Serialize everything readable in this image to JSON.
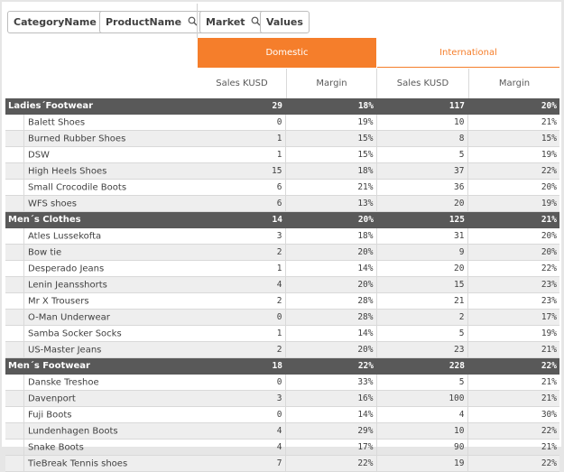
{
  "dimensions": [
    {
      "label": "CategoryName",
      "icon": "search-icon"
    },
    {
      "label": "ProductName",
      "icon": "search-icon"
    }
  ],
  "columns_dims": [
    {
      "label": "Market",
      "icon": "search-icon"
    },
    {
      "label": "Values",
      "icon": ""
    }
  ],
  "markets": [
    {
      "label": "Domestic",
      "selected": true
    },
    {
      "label": "International",
      "selected": false
    }
  ],
  "measures": [
    "Sales KUSD",
    "Margin",
    "Sales KUSD",
    "Margin"
  ],
  "colors": {
    "accent": "#f57e2b",
    "group_header": "#595959",
    "alt_row": "#eeeeee"
  },
  "groups": [
    {
      "name": "Ladies´Footwear",
      "values": [
        "29",
        "18%",
        "117",
        "20%"
      ],
      "rows": [
        {
          "name": "Balett Shoes",
          "values": [
            "0",
            "19%",
            "10",
            "21%"
          ]
        },
        {
          "name": "Burned Rubber Shoes",
          "values": [
            "1",
            "15%",
            "8",
            "15%"
          ]
        },
        {
          "name": "DSW",
          "values": [
            "1",
            "15%",
            "5",
            "19%"
          ]
        },
        {
          "name": "High Heels Shoes",
          "values": [
            "15",
            "18%",
            "37",
            "22%"
          ]
        },
        {
          "name": "Small Crocodile Boots",
          "values": [
            "6",
            "21%",
            "36",
            "20%"
          ]
        },
        {
          "name": "WFS shoes",
          "values": [
            "6",
            "13%",
            "20",
            "19%"
          ]
        }
      ]
    },
    {
      "name": "Men´s Clothes",
      "values": [
        "14",
        "20%",
        "125",
        "21%"
      ],
      "rows": [
        {
          "name": "Atles Lussekofta",
          "values": [
            "3",
            "18%",
            "31",
            "20%"
          ]
        },
        {
          "name": "Bow tie",
          "values": [
            "2",
            "20%",
            "9",
            "20%"
          ]
        },
        {
          "name": "Desperado Jeans",
          "values": [
            "1",
            "14%",
            "20",
            "22%"
          ]
        },
        {
          "name": "Lenin Jeansshorts",
          "values": [
            "4",
            "20%",
            "15",
            "23%"
          ]
        },
        {
          "name": "Mr X Trousers",
          "values": [
            "2",
            "28%",
            "21",
            "23%"
          ]
        },
        {
          "name": "O-Man Underwear",
          "values": [
            "0",
            "28%",
            "2",
            "17%"
          ]
        },
        {
          "name": "Samba Socker Socks",
          "values": [
            "1",
            "14%",
            "5",
            "19%"
          ]
        },
        {
          "name": "US-Master Jeans",
          "values": [
            "2",
            "20%",
            "23",
            "21%"
          ]
        }
      ]
    },
    {
      "name": "Men´s Footwear",
      "values": [
        "18",
        "22%",
        "228",
        "22%"
      ],
      "rows": [
        {
          "name": "Danske Treshoe",
          "values": [
            "0",
            "33%",
            "5",
            "21%"
          ]
        },
        {
          "name": "Davenport",
          "values": [
            "3",
            "16%",
            "100",
            "21%"
          ]
        },
        {
          "name": "Fuji Boots",
          "values": [
            "0",
            "14%",
            "4",
            "30%"
          ]
        },
        {
          "name": "Lundenhagen Boots",
          "values": [
            "4",
            "29%",
            "10",
            "22%"
          ]
        },
        {
          "name": "Snake Boots",
          "values": [
            "4",
            "17%",
            "90",
            "21%"
          ]
        },
        {
          "name": "TieBreak Tennis shoes",
          "values": [
            "7",
            "22%",
            "19",
            "22%"
          ]
        }
      ]
    }
  ]
}
